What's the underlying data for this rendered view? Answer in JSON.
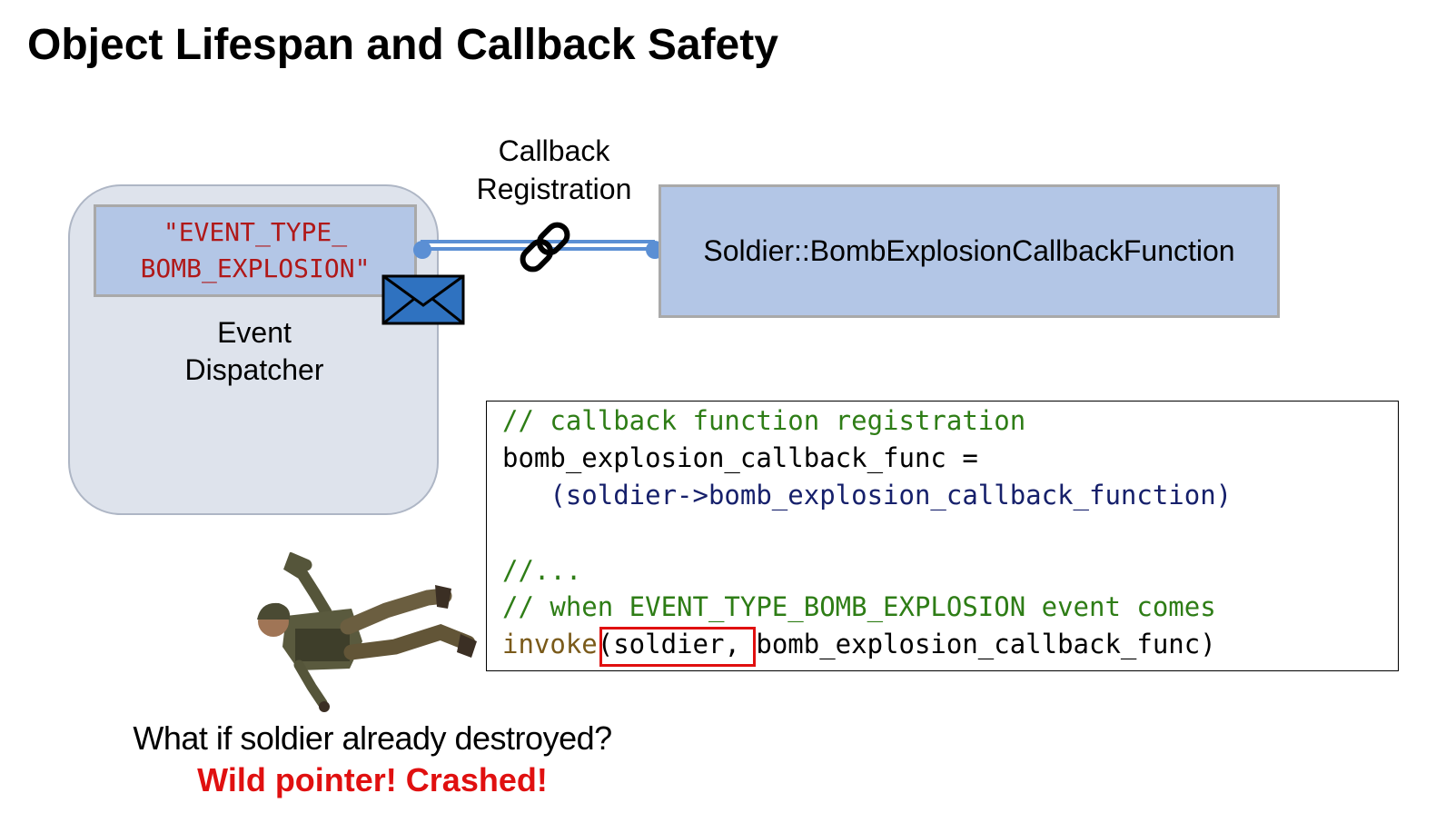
{
  "slide": {
    "title": "Object Lifespan and Callback Safety"
  },
  "dispatcher": {
    "event_type_line1": "\"EVENT_TYPE_",
    "event_type_line2": "BOMB_EXPLOSION\"",
    "label_line1": "Event",
    "label_line2": "Dispatcher"
  },
  "registration": {
    "label_line1": "Callback",
    "label_line2": "Registration"
  },
  "soldier_callback": {
    "label": "Soldier::BombExplosionCallbackFunction"
  },
  "code": {
    "line1": "// callback function registration",
    "line2": "bomb_explosion_callback_func =",
    "line3": "   (soldier->bomb_explosion_callback_function)",
    "line4": "//...",
    "line5": "// when EVENT_TYPE_BOMB_EXPLOSION event comes",
    "line6_invoke": "invoke",
    "line6_rest": "(soldier, bomb_explosion_callback_func)"
  },
  "caption": {
    "question": "What if soldier already destroyed?",
    "answer": "Wild pointer! Crashed!"
  },
  "colors": {
    "box_blue": "#b3c6e6",
    "dispatcher_gray": "#dee3ec",
    "warning_red": "#e01010",
    "comment_green": "#2e7d16"
  },
  "icons": [
    "link-icon",
    "envelope-icon",
    "soldier-illustration"
  ]
}
